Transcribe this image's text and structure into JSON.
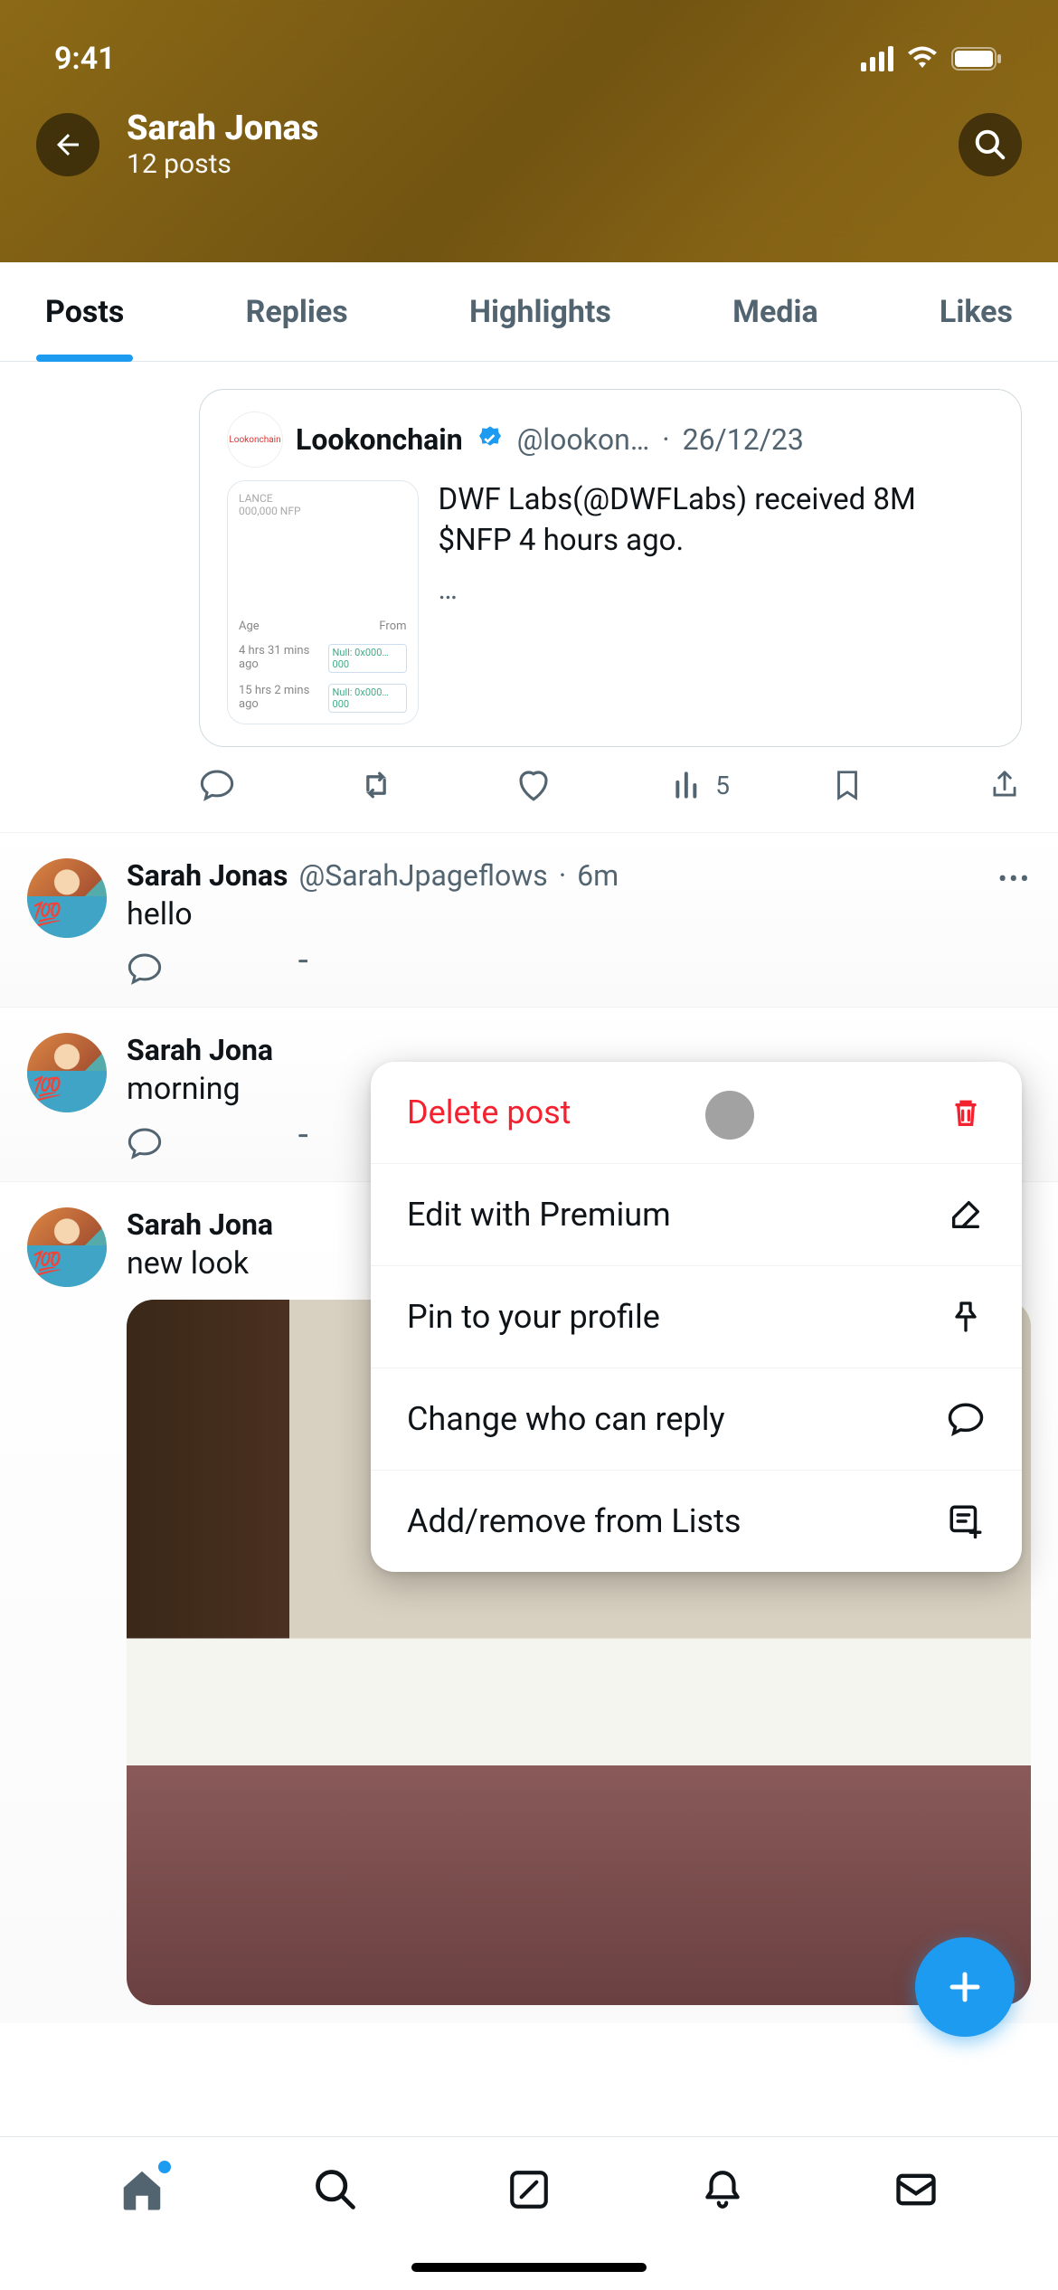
{
  "status": {
    "time": "9:41"
  },
  "header": {
    "name": "Sarah Jonas",
    "subtitle": "12 posts"
  },
  "tabs": [
    "Posts",
    "Replies",
    "Highlights",
    "Media",
    "Likes"
  ],
  "active_tab": 0,
  "quoted_post": {
    "account_name": "Lookonchain",
    "handle": "@lookon…",
    "date": "26/12/23",
    "body": "DWF Labs(@DWFLabs) received 8M $NFP 4 hours ago.",
    "more": "…",
    "thumb": {
      "line1": "LANCE",
      "line2": "000,000 NFP",
      "col1": "Age",
      "col2": "From",
      "r1_age": "4 hrs 31 mins ago",
      "r1_from": "Null: 0x000…000",
      "r2_age": "15 hrs 2 mins ago",
      "r2_from": "Null: 0x000…000"
    },
    "views": "5"
  },
  "posts": [
    {
      "name": "Sarah Jonas",
      "handle": "@SarahJpageflows",
      "time": "6m",
      "text": "hello"
    },
    {
      "name": "Sarah Jona",
      "text": "morning"
    },
    {
      "name": "Sarah Jona",
      "text": "new look"
    }
  ],
  "menu": {
    "delete": "Delete post",
    "edit": "Edit with Premium",
    "pin": "Pin to your profile",
    "reply": "Change who can reply",
    "lists": "Add/remove from Lists"
  }
}
